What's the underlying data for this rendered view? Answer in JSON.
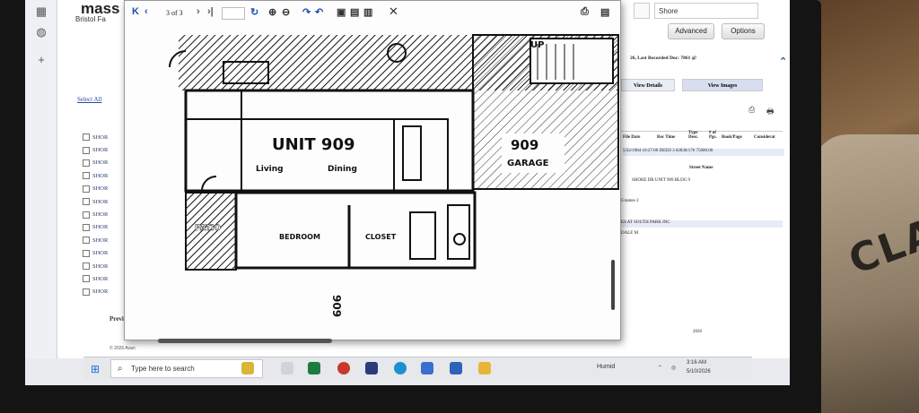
{
  "browser": {
    "logo": "mass",
    "logo_sub": "Bristol Fa"
  },
  "left_panel": {
    "select_all": "Select All",
    "results": [
      "SHOR",
      "SHOR",
      "SHOR",
      "SHOR",
      "SHOR",
      "SHOR",
      "SHOR",
      "SHOR",
      "SHOR",
      "SHOR",
      "SHOR",
      "SHOR",
      "SHOR"
    ],
    "previous": "Previous",
    "copyright": "© 2026 Avan"
  },
  "right_panel": {
    "search_value": "Shore",
    "advanced_label": "Advanced",
    "options_label": "Options",
    "last_recorded": "26, Last Recorded Doc: 7861 @",
    "tab_view_details": "View Details",
    "tab_view_images": "View Images",
    "col_file_date": "File Date",
    "col_rec_time": "Rec Time",
    "col_type_desc": "Type Desc.",
    "col_num_pgs": "# of Pgs.",
    "col_book_page": "Book/Page",
    "col_consideration": "Considerat",
    "row_values": "5/22/1984 10:27:00 DEED 3    02830/176  75000.00",
    "street_name_label": "Street Name",
    "street_value": "SHORE DR UNIT 909 BLDG 9",
    "grantee_label": "Grantee 2",
    "party_1": "ES AT SOUTH PARK INC",
    "party_2": "DALE M",
    "footer_year": "2026"
  },
  "viewer": {
    "page_indicator": "3 of 3",
    "plan_labels": {
      "unit": "UNIT 909",
      "garage": "909",
      "garage_word": "GARAGE",
      "living": "Living",
      "dining": "Dining",
      "bedroom": "BEDROOM",
      "closet": "CLOSET",
      "patio": "PATIO",
      "up": "UP",
      "vertical_label": "909"
    }
  },
  "taskbar": {
    "search_placeholder": "Type here to search",
    "weather": "Humid",
    "time": "3:16 AM",
    "date": "5/10/2026"
  },
  "colors": {
    "screen_bg": "#e9ebef",
    "accent": "#1c4fb3",
    "taskbar": "#e6e8ec"
  }
}
